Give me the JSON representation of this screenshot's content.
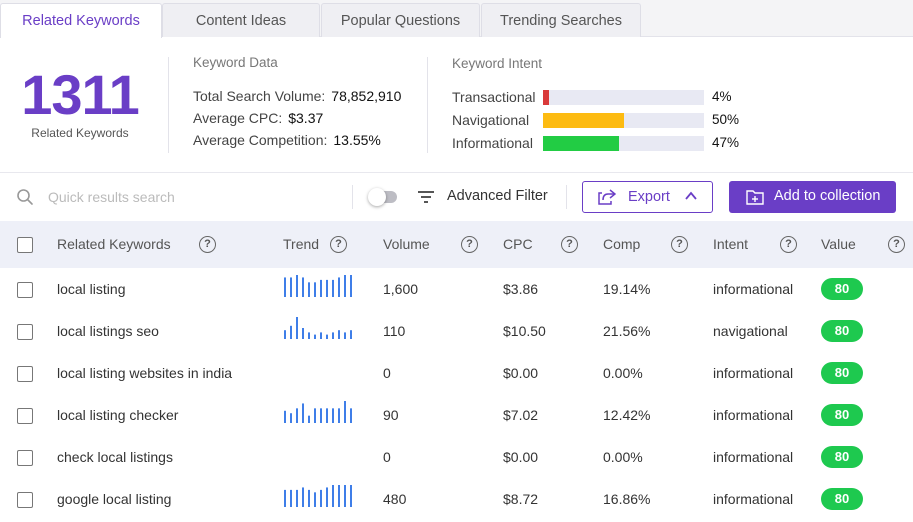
{
  "tabs": [
    {
      "label": "Related Keywords",
      "active": true
    },
    {
      "label": "Content Ideas",
      "active": false
    },
    {
      "label": "Popular Questions",
      "active": false
    },
    {
      "label": "Trending Searches",
      "active": false
    }
  ],
  "summary": {
    "count": "1311",
    "count_label": "Related Keywords",
    "keyword_data": {
      "title": "Keyword Data",
      "total_search_volume_label": "Total Search Volume:",
      "total_search_volume": "78,852,910",
      "average_cpc_label": "Average CPC:",
      "average_cpc": "$3.37",
      "average_competition_label": "Average Competition:",
      "average_competition": "13.55%"
    },
    "keyword_intent": {
      "title": "Keyword Intent",
      "rows": [
        {
          "label": "Transactional",
          "pct": "4%",
          "fraction": 0.04,
          "color": "#d93a3a"
        },
        {
          "label": "Navigational",
          "pct": "50%",
          "fraction": 0.5,
          "color": "#fdbb11"
        },
        {
          "label": "Informational",
          "pct": "47%",
          "fraction": 0.47,
          "color": "#22cc44"
        }
      ]
    }
  },
  "toolbar": {
    "search_placeholder": "Quick results search",
    "advanced_filter_label": "Advanced Filter",
    "export_label": "Export",
    "add_collection_label": "Add to collection"
  },
  "table": {
    "headers": {
      "keyword": "Related Keywords",
      "trend": "Trend",
      "volume": "Volume",
      "cpc": "CPC",
      "comp": "Comp",
      "intent": "Intent",
      "value": "Value"
    },
    "rows": [
      {
        "keyword": "local listing",
        "trend": [
          8,
          8,
          9,
          8,
          6,
          6,
          7,
          7,
          7,
          8,
          9,
          9
        ],
        "volume": "1,600",
        "cpc": "$3.86",
        "comp": "19.14%",
        "intent": "informational",
        "value": "80"
      },
      {
        "keyword": "local listings seo",
        "trend": [
          4,
          6,
          10,
          5,
          3,
          2,
          3,
          2,
          3,
          4,
          3,
          4
        ],
        "volume": "110",
        "cpc": "$10.50",
        "comp": "21.56%",
        "intent": "navigational",
        "value": "80"
      },
      {
        "keyword": "local listing websites in india",
        "trend": [],
        "volume": "0",
        "cpc": "$0.00",
        "comp": "0.00%",
        "intent": "informational",
        "value": "80"
      },
      {
        "keyword": "local listing checker",
        "trend": [
          5,
          4,
          6,
          8,
          3,
          6,
          6,
          6,
          6,
          6,
          9,
          6
        ],
        "volume": "90",
        "cpc": "$7.02",
        "comp": "12.42%",
        "intent": "informational",
        "value": "80"
      },
      {
        "keyword": "check local listings",
        "trend": [],
        "volume": "0",
        "cpc": "$0.00",
        "comp": "0.00%",
        "intent": "informational",
        "value": "80"
      },
      {
        "keyword": "google local listing",
        "trend": [
          7,
          7,
          7,
          8,
          7,
          6,
          7,
          8,
          9,
          9,
          9,
          9
        ],
        "volume": "480",
        "cpc": "$8.72",
        "comp": "16.86%",
        "intent": "informational",
        "value": "80"
      }
    ]
  },
  "colors": {
    "accent": "#6a3ec6",
    "trend_bar": "#3f7ee8",
    "badge": "#1ec94f"
  }
}
